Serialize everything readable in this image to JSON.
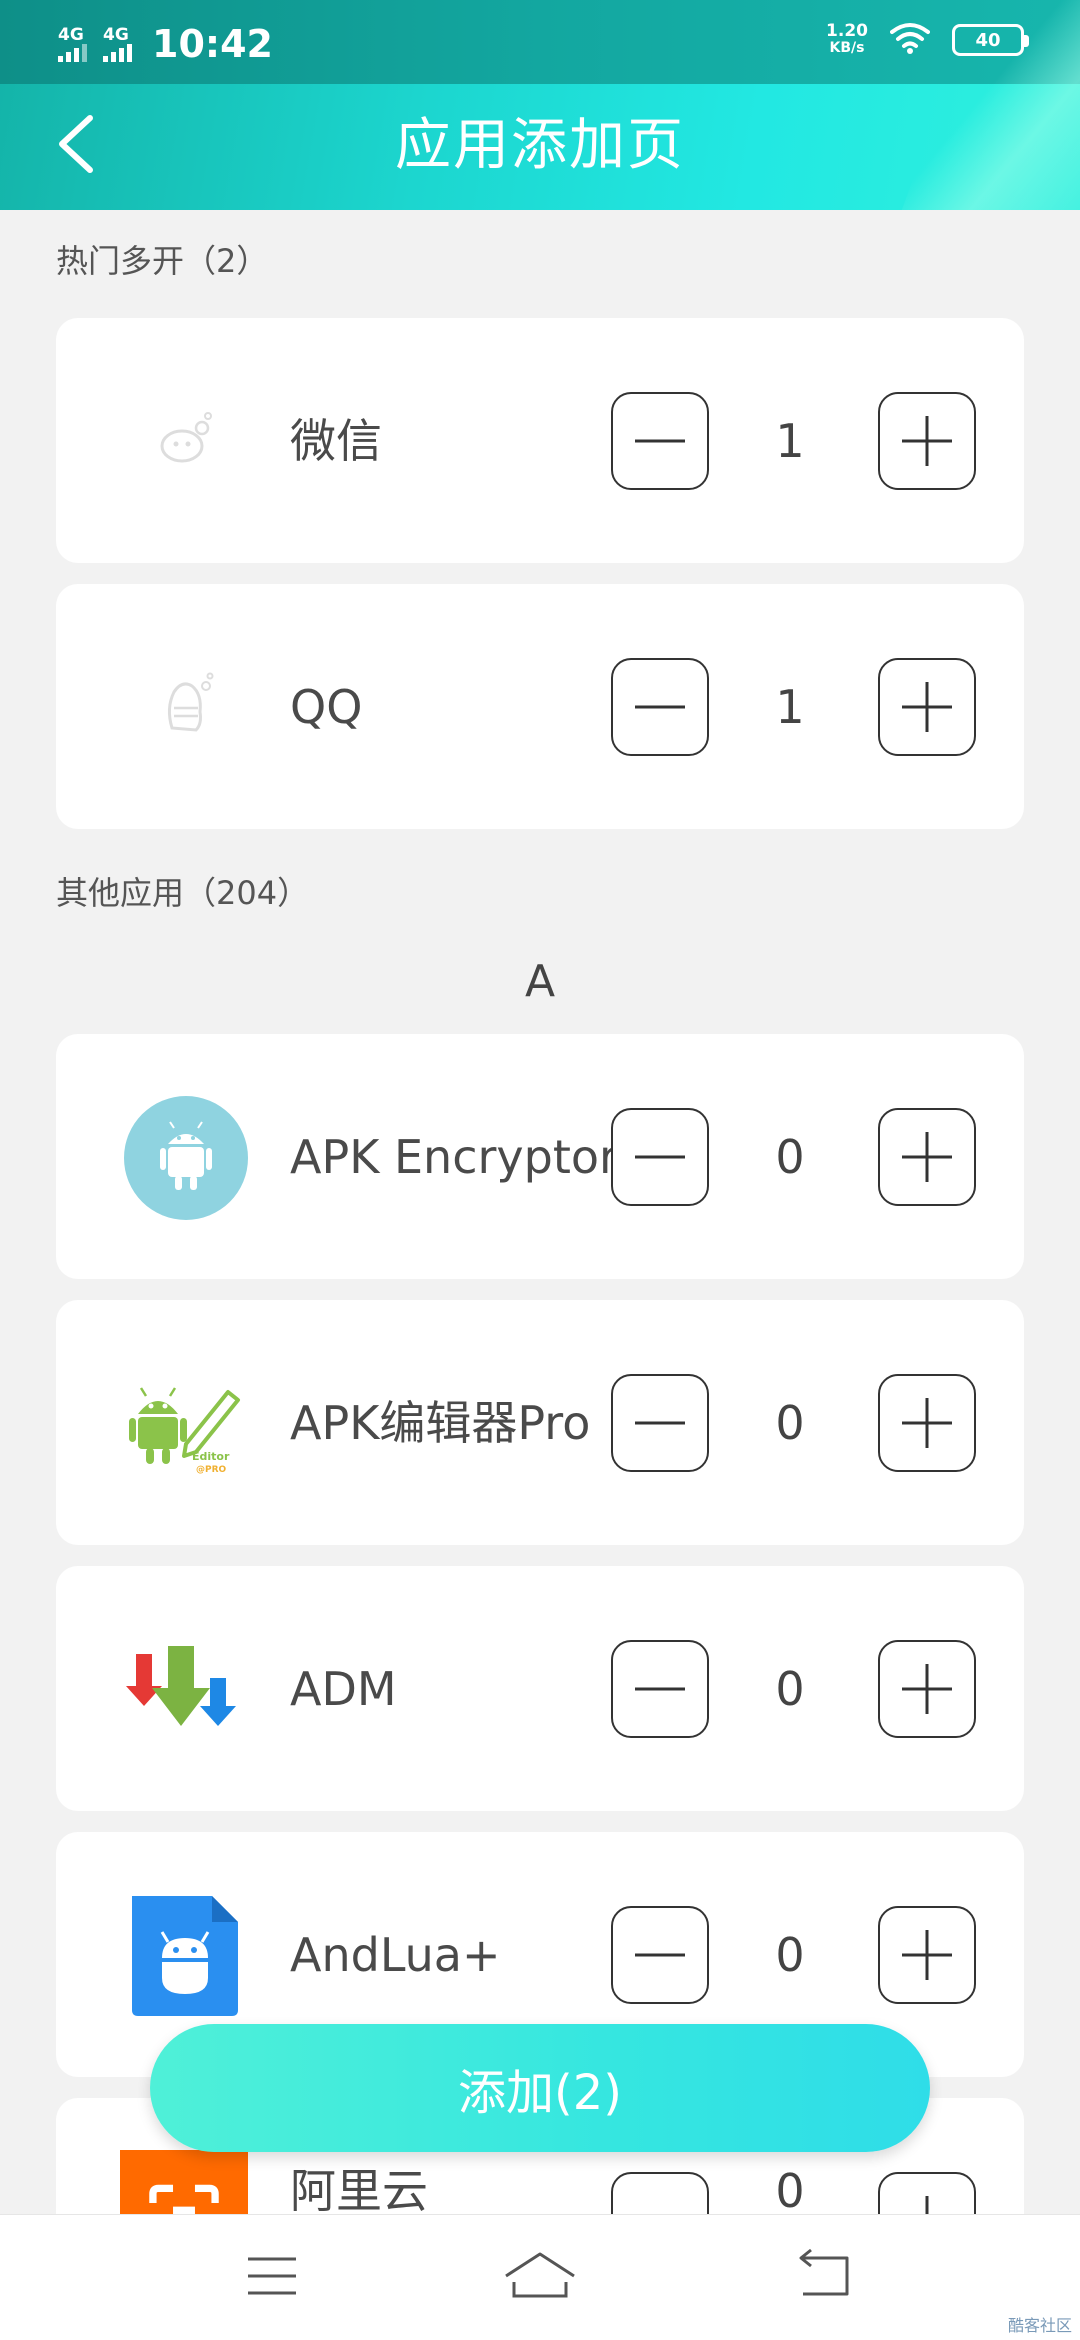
{
  "status_bar": {
    "network1": "4G",
    "network2": "4G",
    "time": "10:42",
    "speed_value": "1.20",
    "speed_unit": "KB/s",
    "battery": "40"
  },
  "header": {
    "title": "应用添加页",
    "back_icon": "chevron-left-icon"
  },
  "hot_section": {
    "label": "热门多开（2）",
    "items": [
      {
        "name": "微信",
        "count": "1",
        "icon": "wechat-placeholder-icon"
      },
      {
        "name": "QQ",
        "count": "1",
        "icon": "qq-placeholder-icon"
      }
    ]
  },
  "other_section": {
    "label": "其他应用（204）",
    "letter": "A",
    "items": [
      {
        "name": "APK Encryptor",
        "count": "0",
        "icon": "android-circle-icon"
      },
      {
        "name": "APK编辑器Pro",
        "count": "0",
        "icon": "apk-editor-icon",
        "icon_text1": "Editor",
        "icon_text2": "@PRO"
      },
      {
        "name": "ADM",
        "count": "0",
        "icon": "adm-download-icon"
      },
      {
        "name": "AndLua+",
        "count": "0",
        "icon": "andlua-file-icon"
      },
      {
        "name": "阿里云",
        "count": "0",
        "icon": "aliyun-icon"
      }
    ]
  },
  "add_button": {
    "label": "添加(2)"
  },
  "navbar": {
    "menu_icon": "menu-icon",
    "home_icon": "home-icon",
    "back_icon": "back-arrow-icon"
  },
  "watermark": "酷客社区",
  "colors": {
    "header_start": "#14b3a8",
    "header_end": "#2ff0dd",
    "add_button": "#35e6e0",
    "background": "#f2f2f2"
  }
}
